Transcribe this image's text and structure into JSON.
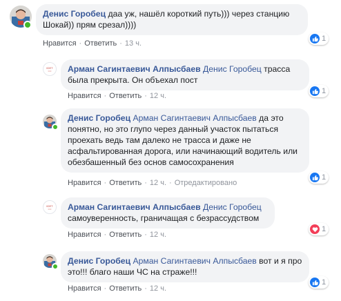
{
  "comments": [
    {
      "author": "Денис Горобец",
      "mention": "",
      "text_line1": "даа уж, нашёл короткий путь))) через станцию",
      "text_line2": "Шокай)) прям срезал))))",
      "like_label": "Нравится",
      "reply_label": "Ответить",
      "time": "13 ч.",
      "reaction_count": "1",
      "reaction_icon": "like-icon"
    },
    {
      "author": "Арман Сагинтаевич Алпысбаев",
      "mention": "Денис Горобец",
      "text_line1": "трасса",
      "text_line2": "была прекрыта. Он объехал пост",
      "like_label": "Нравится",
      "reply_label": "Ответить",
      "time": "12 ч.",
      "reaction_count": "1",
      "reaction_icon": "like-icon"
    },
    {
      "author": "Денис Горобец",
      "mention": "Арман Сагинтаевич Алпысбаев",
      "text_line1": "да это",
      "text_line2": "понятно, но это глупо через данный участок пытаться",
      "text_line3": "проехать ведь там далеко не трасса и даже не",
      "text_line4": "асфальтированная дорога, или начинающий водитель или",
      "text_line5": "обезбашенный без основ самосохранения",
      "like_label": "Нравится",
      "reply_label": "Ответить",
      "time": "12 ч.",
      "edited_label": "Отредактировано",
      "reaction_count": "1",
      "reaction_icon": "like-icon"
    },
    {
      "author": "Арман Сагинтаевич Алпысбаев",
      "mention": "Денис Горобец",
      "text_line1": "самоуверенность, граничащая с безрассудством",
      "like_label": "Нравится",
      "reply_label": "Ответить",
      "time": "12 ч.",
      "reaction_count": "1",
      "reaction_icon": "love-icon"
    },
    {
      "author": "Денис Горобец",
      "mention": "Арман Сагинтаевич Алпысбаев",
      "text_line1": "вот и я про",
      "text_line2": "это!!! благо наши ЧС на страже!!!",
      "like_label": "Нравится",
      "reply_label": "Ответить",
      "time": "12 ч.",
      "reaction_count": "1",
      "reaction_icon": "like-icon"
    }
  ],
  "colors": {
    "author": "#385898",
    "bubble": "#f2f3f5",
    "like": "#1877f2",
    "love": "#f33e58",
    "online": "#42b72a"
  }
}
